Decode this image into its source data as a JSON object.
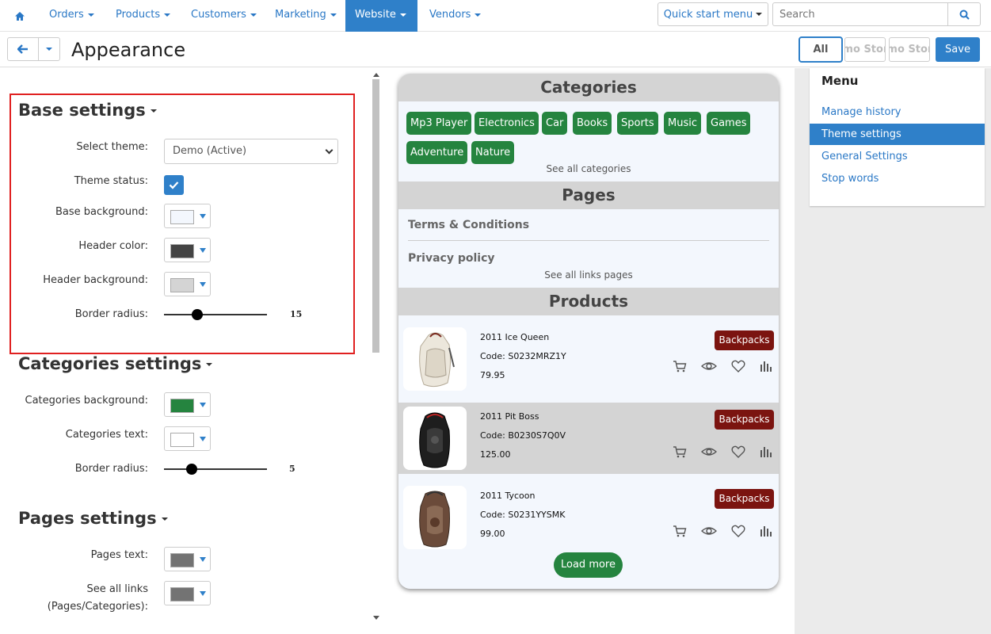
{
  "nav": {
    "items": [
      {
        "label": "Orders"
      },
      {
        "label": "Products"
      },
      {
        "label": "Customers"
      },
      {
        "label": "Marketing"
      },
      {
        "label": "Website"
      },
      {
        "label": "Vendors"
      }
    ],
    "quick_start": "Quick start menu",
    "search_placeholder": "Search"
  },
  "titlebar": {
    "title": "Appearance",
    "store_all": "All",
    "store_1": "Demo Store",
    "store_2": "Demo Store",
    "save": "Save"
  },
  "base_settings": {
    "title": "Base settings",
    "select_theme_label": "Select theme:",
    "select_theme_value": "Demo (Active)",
    "theme_status_label": "Theme status:",
    "theme_status_checked": true,
    "base_background_label": "Base background:",
    "base_background_color": "#f3f7fd",
    "header_color_label": "Header color:",
    "header_color_value": "#444444",
    "header_background_label": "Header background:",
    "header_background_color": "#d4d4d4",
    "border_radius_label": "Border radius:",
    "border_radius_value": "15"
  },
  "categories_settings": {
    "title": "Categories settings",
    "background_label": "Categories background:",
    "background_color": "#25843f",
    "text_label": "Categories text:",
    "text_color": "#ffffff",
    "border_radius_label": "Border radius:",
    "border_radius_value": "5"
  },
  "pages_settings": {
    "title": "Pages settings",
    "pages_text_label": "Pages text:",
    "pages_text_color": "#737373",
    "see_all_links_label_1": "See all links",
    "see_all_links_label_2": "(Pages/Categories):",
    "see_all_links_color": "#737373"
  },
  "preview": {
    "categories_title": "Categories",
    "categories": [
      "Mp3 Player",
      "Electronics",
      "Car",
      "Books",
      "Sports",
      "Music",
      "Games",
      "Adventure",
      "Nature"
    ],
    "see_all_categories": "See all categories",
    "pages_title": "Pages",
    "pages": [
      "Terms & Conditions",
      "Privacy policy"
    ],
    "see_all_pages": "See all links pages",
    "products_title": "Products",
    "products": [
      {
        "name": "2011 Ice Queen",
        "code": "Code: S0232MRZ1Y",
        "price": "79.95",
        "badge": "Backpacks"
      },
      {
        "name": "2011 Pit Boss",
        "code": "Code: B0230S7Q0V",
        "price": "125.00",
        "badge": "Backpacks"
      },
      {
        "name": "2011 Tycoon",
        "code": "Code: S0231YYSMK",
        "price": "99.00",
        "badge": "Backpacks"
      }
    ],
    "load_more": "Load more"
  },
  "menu": {
    "title": "Menu",
    "items": [
      "Manage history",
      "Theme settings",
      "General Settings",
      "Stop words"
    ]
  },
  "colors": {
    "accent": "#2f80c9",
    "category_green": "#25843f",
    "badge_red": "#7b1410"
  }
}
